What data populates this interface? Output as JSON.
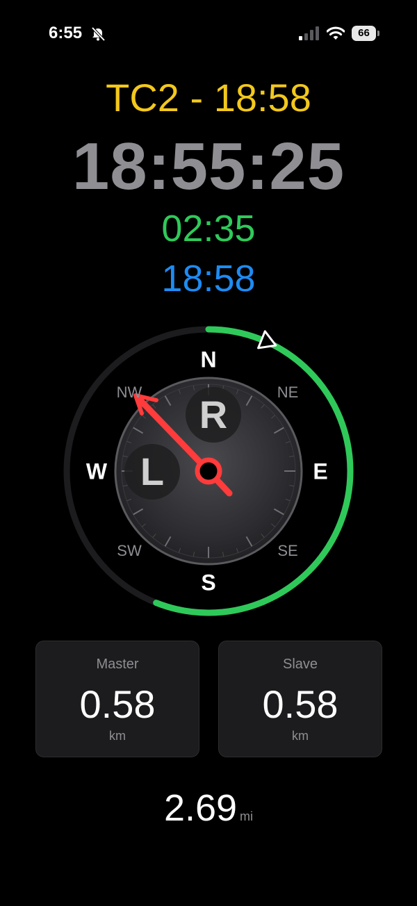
{
  "status_bar": {
    "time": "6:55",
    "battery": "66",
    "icons": [
      "bell-slash-icon",
      "signal-icon",
      "wifi-icon",
      "battery-icon"
    ]
  },
  "header": {
    "title": "TC2 - 18:58",
    "clock": "18:55:25",
    "countdown": "02:35",
    "target": "18:58"
  },
  "compass": {
    "directions": {
      "n": "N",
      "s": "S",
      "e": "E",
      "w": "W",
      "ne": "NE",
      "nw": "NW",
      "se": "SE",
      "sw": "SW"
    },
    "right_badge": "R",
    "left_badge": "L",
    "progress_fraction": 0.56,
    "heading_direction": "NW",
    "colors": {
      "progress": "#2fc95a",
      "track": "#1c1c1e",
      "needle": "#ff3b3b"
    }
  },
  "cards": {
    "master": {
      "title": "Master",
      "value": "0.58",
      "unit": "km"
    },
    "slave": {
      "title": "Slave",
      "value": "0.58",
      "unit": "km"
    }
  },
  "total": {
    "value": "2.69",
    "unit": "mi"
  },
  "colors": {
    "title": "#f2c81c",
    "clock": "#8e8e93",
    "countdown": "#2fc95a",
    "target": "#1e8bf2"
  }
}
